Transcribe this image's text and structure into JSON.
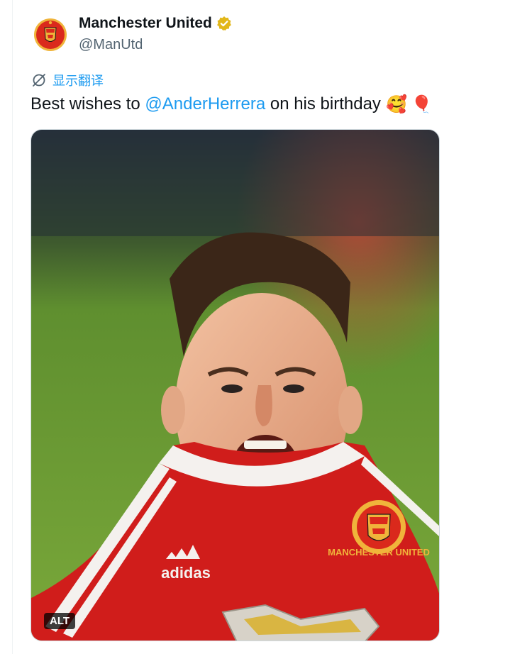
{
  "author": {
    "name": "Manchester United",
    "handle": "@ManUtd",
    "verified_icon": "verified-badge-gold"
  },
  "translate": {
    "label": "显示翻译",
    "icon": "translate-icon"
  },
  "tweet": {
    "text_before": "Best wishes to ",
    "mention": "@AnderHerrera",
    "text_after": " on his birthday",
    "emoji_1": "🥰",
    "emoji_2": "🎈"
  },
  "crest": {
    "text": "MANCHESTER UNITED"
  },
  "shirt": {
    "brand": "adidas"
  },
  "media": {
    "alt_label": "ALT"
  },
  "colors": {
    "accent": "#1d9bf0",
    "text": "#0f1419",
    "muted": "#536471",
    "united_red": "#da291c",
    "gold": "#f0b43b"
  }
}
